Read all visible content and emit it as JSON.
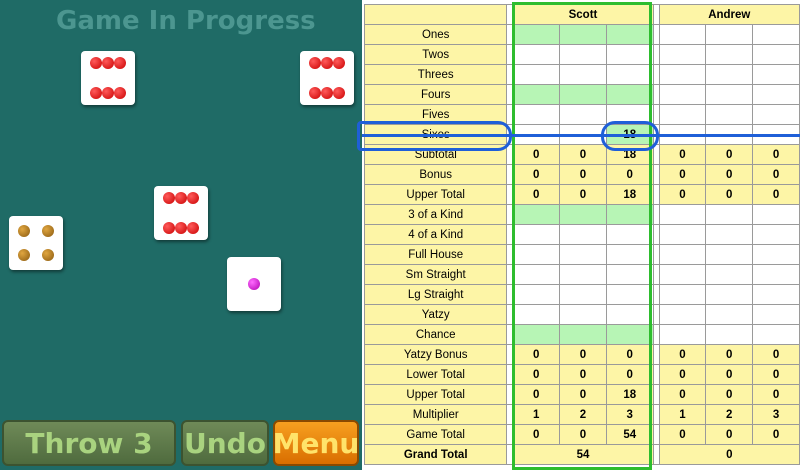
{
  "board": {
    "title": "Game In Progress",
    "dice": [
      {
        "value": 6,
        "pip_color": "red"
      },
      {
        "value": 6,
        "pip_color": "red"
      },
      {
        "value": 6,
        "pip_color": "red"
      },
      {
        "value": 4,
        "pip_color": "gold"
      },
      {
        "value": 1,
        "pip_color": "magenta"
      }
    ],
    "buttons": {
      "throw": "Throw 3",
      "undo": "Undo",
      "menu": "Menu"
    }
  },
  "scorecard": {
    "players": [
      "Scott",
      "Andrew"
    ],
    "selected_row": "Sixes",
    "rows": [
      {
        "label": "Ones",
        "type": "input",
        "scott": [
          "",
          "",
          ""
        ],
        "andrew": [
          "",
          "",
          ""
        ],
        "green": [
          true,
          true,
          true
        ]
      },
      {
        "label": "Twos",
        "type": "input",
        "scott": [
          "",
          "",
          ""
        ],
        "andrew": [
          "",
          "",
          ""
        ],
        "green": [
          false,
          false,
          false
        ]
      },
      {
        "label": "Threes",
        "type": "input",
        "scott": [
          "",
          "",
          ""
        ],
        "andrew": [
          "",
          "",
          ""
        ],
        "green": [
          false,
          false,
          false
        ]
      },
      {
        "label": "Fours",
        "type": "input",
        "scott": [
          "",
          "",
          ""
        ],
        "andrew": [
          "",
          "",
          ""
        ],
        "green": [
          true,
          true,
          true
        ]
      },
      {
        "label": "Fives",
        "type": "input",
        "scott": [
          "",
          "",
          ""
        ],
        "andrew": [
          "",
          "",
          ""
        ],
        "green": [
          false,
          false,
          false
        ]
      },
      {
        "label": "Sixes",
        "type": "input",
        "scott": [
          "",
          "",
          "18"
        ],
        "andrew": [
          "",
          "",
          ""
        ],
        "green": [
          false,
          false,
          true
        ]
      },
      {
        "label": "Subtotal",
        "type": "total",
        "scott": [
          "0",
          "0",
          "18"
        ],
        "andrew": [
          "0",
          "0",
          "0"
        ]
      },
      {
        "label": "Bonus",
        "type": "total",
        "scott": [
          "0",
          "0",
          "0"
        ],
        "andrew": [
          "0",
          "0",
          "0"
        ]
      },
      {
        "label": "Upper Total",
        "type": "total",
        "scott": [
          "0",
          "0",
          "18"
        ],
        "andrew": [
          "0",
          "0",
          "0"
        ]
      },
      {
        "label": "3 of a Kind",
        "type": "input",
        "scott": [
          "",
          "",
          ""
        ],
        "andrew": [
          "",
          "",
          ""
        ],
        "green": [
          true,
          true,
          true
        ]
      },
      {
        "label": "4 of a Kind",
        "type": "input",
        "scott": [
          "",
          "",
          ""
        ],
        "andrew": [
          "",
          "",
          ""
        ],
        "green": [
          false,
          false,
          false
        ]
      },
      {
        "label": "Full House",
        "type": "input",
        "scott": [
          "",
          "",
          ""
        ],
        "andrew": [
          "",
          "",
          ""
        ],
        "green": [
          false,
          false,
          false
        ]
      },
      {
        "label": "Sm Straight",
        "type": "input",
        "scott": [
          "",
          "",
          ""
        ],
        "andrew": [
          "",
          "",
          ""
        ],
        "green": [
          false,
          false,
          false
        ]
      },
      {
        "label": "Lg Straight",
        "type": "input",
        "scott": [
          "",
          "",
          ""
        ],
        "andrew": [
          "",
          "",
          ""
        ],
        "green": [
          false,
          false,
          false
        ]
      },
      {
        "label": "Yatzy",
        "type": "input",
        "scott": [
          "",
          "",
          ""
        ],
        "andrew": [
          "",
          "",
          ""
        ],
        "green": [
          false,
          false,
          false
        ]
      },
      {
        "label": "Chance",
        "type": "input",
        "scott": [
          "",
          "",
          ""
        ],
        "andrew": [
          "",
          "",
          ""
        ],
        "green": [
          true,
          true,
          true
        ]
      },
      {
        "label": "Yatzy Bonus",
        "type": "total",
        "scott": [
          "0",
          "0",
          "0"
        ],
        "andrew": [
          "0",
          "0",
          "0"
        ]
      },
      {
        "label": "Lower Total",
        "type": "total",
        "scott": [
          "0",
          "0",
          "0"
        ],
        "andrew": [
          "0",
          "0",
          "0"
        ]
      },
      {
        "label": "Upper Total",
        "type": "total",
        "scott": [
          "0",
          "0",
          "18"
        ],
        "andrew": [
          "0",
          "0",
          "0"
        ]
      },
      {
        "label": "Multiplier",
        "type": "total",
        "scott": [
          "1",
          "2",
          "3"
        ],
        "andrew": [
          "1",
          "2",
          "3"
        ]
      },
      {
        "label": "Game Total",
        "type": "total",
        "scott": [
          "0",
          "0",
          "54"
        ],
        "andrew": [
          "0",
          "0",
          "0"
        ]
      }
    ],
    "grand_total": {
      "label": "Grand Total",
      "scott": "54",
      "andrew": "0"
    }
  },
  "colors": {
    "board_bg": "#1f6b66",
    "label_yellow": "#fdf5a6",
    "available_green": "#b7f5b5",
    "highlight_blue": "#1f5fd8",
    "active_player_frame": "#2ebd2e",
    "menu_orange": "#f7a020"
  }
}
